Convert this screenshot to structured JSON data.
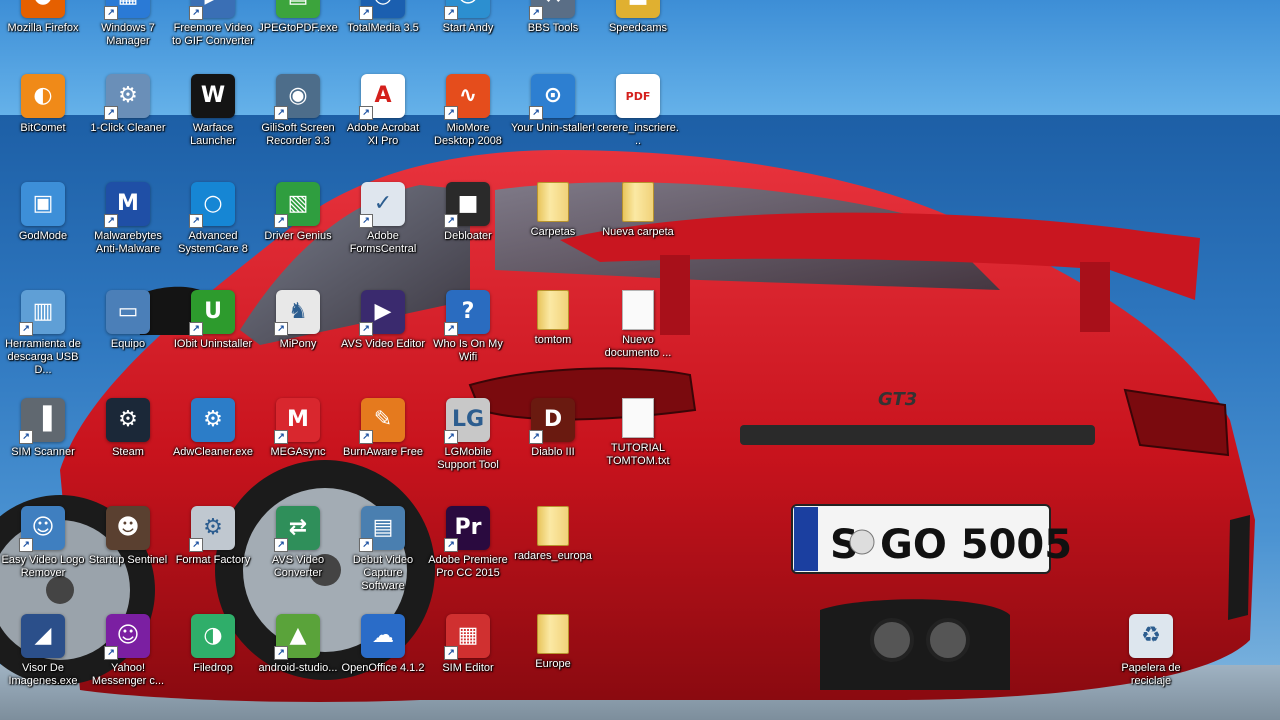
{
  "desktop": {
    "icons": [
      {
        "label": "Mozilla Firefox",
        "icon": "firefox-icon",
        "color": "#e66000",
        "glyph": "●",
        "kind": "app",
        "shortcut": false
      },
      {
        "label": "Windows 7 Manager",
        "icon": "windows-manager-icon",
        "color": "#2a7ad6",
        "glyph": "▦",
        "kind": "app",
        "shortcut": true
      },
      {
        "label": "Freemore Video to GIF Converter",
        "icon": "gif-converter-icon",
        "color": "#3a6fb5",
        "glyph": "▶",
        "kind": "app",
        "shortcut": true
      },
      {
        "label": "JPEGtoPDF.exe",
        "icon": "jpeg-to-pdf-icon",
        "color": "#3ca43c",
        "glyph": "▤",
        "kind": "app",
        "shortcut": false
      },
      {
        "label": "TotalMedia 3.5",
        "icon": "totalmedia-icon",
        "color": "#1b5fb0",
        "glyph": "◎",
        "kind": "app",
        "shortcut": true
      },
      {
        "label": "Start Andy",
        "icon": "andy-icon",
        "color": "#2c8fd0",
        "glyph": "☺",
        "kind": "app",
        "shortcut": true
      },
      {
        "label": "BBS Tools",
        "icon": "bbs-tools-icon",
        "color": "#5a6e86",
        "glyph": "⚒",
        "kind": "app",
        "shortcut": true
      },
      {
        "label": "Speedcams",
        "icon": "speedcams-icon",
        "color": "#e0b030",
        "glyph": "■",
        "kind": "app",
        "shortcut": false
      },
      {
        "label": "BitComet",
        "icon": "bitcomet-icon",
        "color": "#f08a18",
        "glyph": "◐",
        "kind": "app",
        "shortcut": false
      },
      {
        "label": "1-Click Cleaner",
        "icon": "one-click-cleaner-icon",
        "color": "#6a8fb8",
        "glyph": "⚙",
        "kind": "app",
        "shortcut": true
      },
      {
        "label": "Warface Launcher",
        "icon": "warface-icon",
        "color": "#141414",
        "glyph": "W",
        "kind": "app",
        "shortcut": false
      },
      {
        "label": "GiliSoft Screen Recorder 3.3",
        "icon": "screen-recorder-icon",
        "color": "#4d6d8a",
        "glyph": "◉",
        "kind": "app",
        "shortcut": true
      },
      {
        "label": "Adobe Acrobat XI Pro",
        "icon": "adobe-acrobat-icon",
        "color": "#ffffff",
        "glyph": "A",
        "kind": "doc",
        "shortcut": true
      },
      {
        "label": "MioMore Desktop 2008",
        "icon": "miomore-icon",
        "color": "#e54d1c",
        "glyph": "∿",
        "kind": "app",
        "shortcut": true
      },
      {
        "label": "Your Unin-staller!",
        "icon": "uninstaller-icon",
        "color": "#2d7fd1",
        "glyph": "⊙",
        "kind": "app",
        "shortcut": true
      },
      {
        "label": "cerere_inscriere...",
        "icon": "pdf-document-icon",
        "color": "#ffffff",
        "glyph": "PDF",
        "kind": "doc",
        "shortcut": false
      },
      {
        "label": "GodMode",
        "icon": "godmode-icon",
        "color": "#3d8fd8",
        "glyph": "▣",
        "kind": "app",
        "shortcut": false
      },
      {
        "label": "Malwarebytes Anti-Malware",
        "icon": "malwarebytes-icon",
        "color": "#1f4fa6",
        "glyph": "M",
        "kind": "app",
        "shortcut": true
      },
      {
        "label": "Advanced SystemCare 8",
        "icon": "systemcare-icon",
        "color": "#1686d4",
        "glyph": "○",
        "kind": "app",
        "shortcut": true
      },
      {
        "label": "Driver Genius",
        "icon": "driver-genius-icon",
        "color": "#2f9e3f",
        "glyph": "▧",
        "kind": "app",
        "shortcut": true
      },
      {
        "label": "Adobe FormsCentral",
        "icon": "forms-central-icon",
        "color": "#dfe6ee",
        "glyph": "✓",
        "kind": "doc",
        "shortcut": true
      },
      {
        "label": "Debloater",
        "icon": "debloater-icon",
        "color": "#2a2a2a",
        "glyph": "■",
        "kind": "app",
        "shortcut": true
      },
      {
        "label": "Carpetas",
        "icon": "folder-icon",
        "kind": "folder",
        "shortcut": false
      },
      {
        "label": "Nueva carpeta",
        "icon": "folder-icon",
        "kind": "folder",
        "shortcut": false
      },
      {
        "label": "Herramienta de descarga USB D...",
        "icon": "usb-download-tool-icon",
        "color": "#5f9fd6",
        "glyph": "▥",
        "kind": "app",
        "shortcut": true
      },
      {
        "label": "Equipo",
        "icon": "computer-icon",
        "color": "#4b7fb8",
        "glyph": "▭",
        "kind": "app",
        "shortcut": false
      },
      {
        "label": "IObit Uninstaller",
        "icon": "iobit-uninstaller-icon",
        "color": "#2d9b2d",
        "glyph": "U",
        "kind": "app",
        "shortcut": true
      },
      {
        "label": "MiPony",
        "icon": "mipony-icon",
        "color": "#e8e8e8",
        "glyph": "♞",
        "kind": "app",
        "shortcut": true
      },
      {
        "label": "AVS Video Editor",
        "icon": "avs-video-editor-icon",
        "color": "#3a2a6e",
        "glyph": "▶",
        "kind": "app",
        "shortcut": true
      },
      {
        "label": "Who Is On My Wifi",
        "icon": "wifi-scanner-icon",
        "color": "#2a6cc0",
        "glyph": "?",
        "kind": "app",
        "shortcut": true
      },
      {
        "label": "tomtom",
        "icon": "folder-icon",
        "kind": "folder",
        "shortcut": false
      },
      {
        "label": "Nuevo documento ...",
        "icon": "text-file-icon",
        "kind": "file",
        "shortcut": false
      },
      {
        "label": "SIM Scanner",
        "icon": "sim-scanner-icon",
        "color": "#606870",
        "glyph": "▐",
        "kind": "app",
        "shortcut": true
      },
      {
        "label": "Steam",
        "icon": "steam-icon",
        "color": "#1b2838",
        "glyph": "⚙",
        "kind": "app",
        "shortcut": false
      },
      {
        "label": "AdwCleaner.exe",
        "icon": "adwcleaner-icon",
        "color": "#2c7dc8",
        "glyph": "⚙",
        "kind": "app",
        "shortcut": false
      },
      {
        "label": "MEGAsync",
        "icon": "megasync-icon",
        "color": "#d9272e",
        "glyph": "M",
        "kind": "app",
        "shortcut": true
      },
      {
        "label": "BurnAware Free",
        "icon": "burnaware-icon",
        "color": "#e57a1e",
        "glyph": "✎",
        "kind": "app",
        "shortcut": true
      },
      {
        "label": "LGMobile Support Tool",
        "icon": "lg-mobile-icon",
        "color": "#c8c8c8",
        "glyph": "LG",
        "kind": "app",
        "shortcut": true
      },
      {
        "label": "Diablo III",
        "icon": "diablo-icon",
        "color": "#6a1a10",
        "glyph": "D",
        "kind": "app",
        "shortcut": true
      },
      {
        "label": "TUTORIAL TOMTOM.txt",
        "icon": "text-file-icon",
        "kind": "file",
        "shortcut": false
      },
      {
        "label": "Easy Video Logo Remover",
        "icon": "video-logo-remover-icon",
        "color": "#3f7fc0",
        "glyph": "☺",
        "kind": "app",
        "shortcut": true
      },
      {
        "label": "Startup Sentinel",
        "icon": "startup-sentinel-icon",
        "color": "#5a4030",
        "glyph": "☻",
        "kind": "app",
        "shortcut": false
      },
      {
        "label": "Format Factory",
        "icon": "format-factory-icon",
        "color": "#c0c8d0",
        "glyph": "⚙",
        "kind": "app",
        "shortcut": true
      },
      {
        "label": "AVS Video Converter",
        "icon": "avs-video-converter-icon",
        "color": "#2f8f5a",
        "glyph": "⇄",
        "kind": "app",
        "shortcut": true
      },
      {
        "label": "Debut Video Capture Software",
        "icon": "debut-video-icon",
        "color": "#4a7fb0",
        "glyph": "▤",
        "kind": "app",
        "shortcut": true
      },
      {
        "label": "Adobe Premiere Pro CC 2015",
        "icon": "premiere-pro-icon",
        "color": "#2a0a3f",
        "glyph": "Pr",
        "kind": "app",
        "shortcut": true
      },
      {
        "label": "radares_europa",
        "icon": "folder-icon",
        "kind": "folder",
        "shortcut": false
      },
      {
        "label": "Visor De Imagenes.exe",
        "icon": "image-viewer-icon",
        "color": "#2b4f8a",
        "glyph": "◢",
        "kind": "app",
        "shortcut": false
      },
      {
        "label": "Yahoo! Messenger c...",
        "icon": "yahoo-messenger-icon",
        "color": "#7b1fa2",
        "glyph": "☺",
        "kind": "app",
        "shortcut": true
      },
      {
        "label": "Filedrop",
        "icon": "filedrop-icon",
        "color": "#2fae6a",
        "glyph": "◑",
        "kind": "app",
        "shortcut": false
      },
      {
        "label": "android-studio...",
        "icon": "android-studio-icon",
        "color": "#5aa33a",
        "glyph": "▲",
        "kind": "app",
        "shortcut": true
      },
      {
        "label": "OpenOffice 4.1.2",
        "icon": "openoffice-icon",
        "color": "#2a6cc8",
        "glyph": "☁",
        "kind": "app",
        "shortcut": false
      },
      {
        "label": "SIM Editor",
        "icon": "sim-editor-icon",
        "color": "#d03030",
        "glyph": "▦",
        "kind": "app",
        "shortcut": true
      },
      {
        "label": "Europe",
        "icon": "folder-icon",
        "kind": "folder",
        "shortcut": false
      },
      {
        "label": "Papelera de reciclaje",
        "icon": "recycle-bin-icon",
        "color": "#dde6ee",
        "glyph": "♻",
        "kind": "app",
        "shortcut": false
      }
    ]
  }
}
